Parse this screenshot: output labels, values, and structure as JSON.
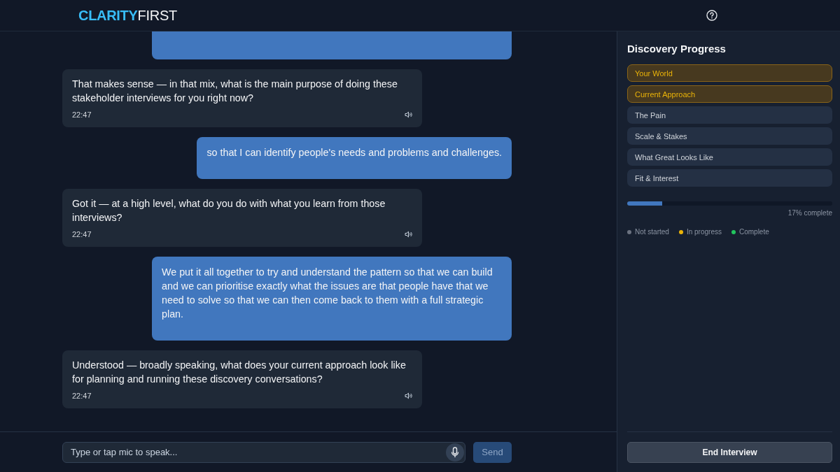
{
  "header": {
    "logo_bold": "CLARITY",
    "logo_light": "FIRST"
  },
  "messages": [
    {
      "kind": "user",
      "clipped": true
    },
    {
      "kind": "assistant",
      "text": "That makes sense — in that mix, what is the main purpose of doing these stakeholder interviews for you right now?",
      "time": "22:47"
    },
    {
      "kind": "user",
      "text": "so that I can identify people's needs and problems and challenges."
    },
    {
      "kind": "assistant",
      "text": "Got it — at a high level, what do you do with what you learn from those interviews?",
      "time": "22:47"
    },
    {
      "kind": "user",
      "text": "We put it all together to try and understand the pattern so that we can build and we can prioritise exactly what the issues are that people have that we need to solve so that we can then come back to them with a full strategic plan."
    },
    {
      "kind": "assistant",
      "text": "Understood — broadly speaking, what does your current approach look like for planning and running these discovery conversations?",
      "time": "22:47"
    }
  ],
  "composer": {
    "placeholder": "Type or tap mic to speak...",
    "send": "Send"
  },
  "sidebar": {
    "title": "Discovery Progress",
    "stages": [
      {
        "label": "Your World",
        "in_progress": true
      },
      {
        "label": "Current Approach",
        "in_progress": true
      },
      {
        "label": "The Pain",
        "in_progress": false
      },
      {
        "label": "Scale & Stakes",
        "in_progress": false
      },
      {
        "label": "What Great Looks Like",
        "in_progress": false
      },
      {
        "label": "Fit & Interest",
        "in_progress": false
      }
    ],
    "progress": {
      "level": 0.17,
      "reading": "17% complete"
    },
    "legend": [
      {
        "label": "Not started",
        "color": "#6b7280"
      },
      {
        "label": "In progress",
        "color": "#eab308"
      },
      {
        "label": "Complete",
        "color": "#22c55e"
      }
    ],
    "end_button": "End Interview"
  }
}
